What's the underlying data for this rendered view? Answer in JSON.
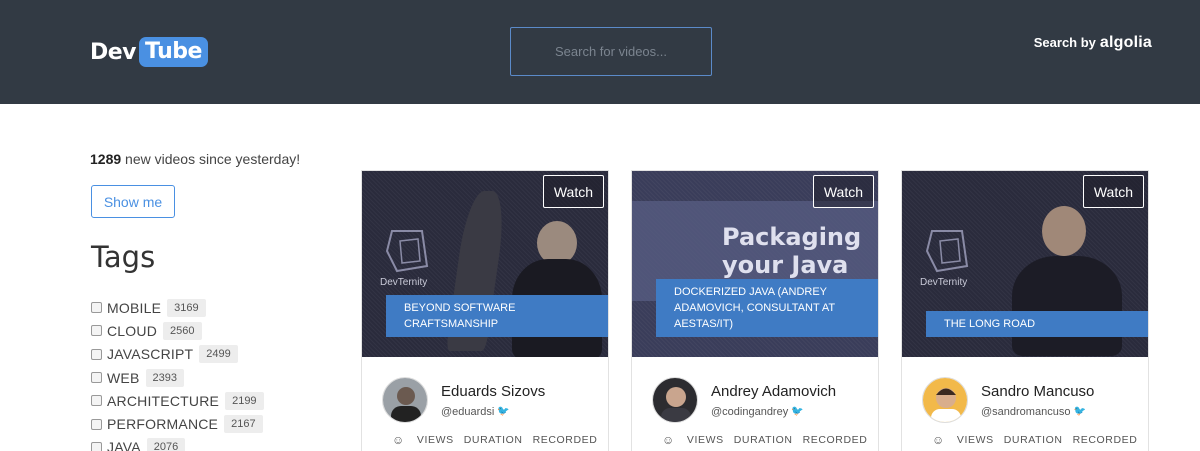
{
  "header": {
    "logo_dev": "Dev",
    "logo_tube": "Tube",
    "search_placeholder": "Search for videos...",
    "search_by": "Search by",
    "algolia": "algolia"
  },
  "sidebar": {
    "new_count": "1289",
    "new_text": " new videos since yesterday!",
    "show_me": "Show me",
    "tags_title": "Tags",
    "tags": [
      {
        "name": "MOBILE",
        "count": "3169"
      },
      {
        "name": "CLOUD",
        "count": "2560"
      },
      {
        "name": "JAVASCRIPT",
        "count": "2499"
      },
      {
        "name": "WEB",
        "count": "2393"
      },
      {
        "name": "ARCHITECTURE",
        "count": "2199"
      },
      {
        "name": "PERFORMANCE",
        "count": "2167"
      },
      {
        "name": "JAVA",
        "count": "2076"
      }
    ]
  },
  "videos": [
    {
      "watch": "Watch",
      "thumb_brand": "DevTernity",
      "caption": "BEYOND SOFTWARE CRAFTSMANSHIP",
      "speaker": "Eduards Sizovs",
      "handle": "@eduardsi",
      "stats": [
        "VIEWS",
        "DURATION",
        "RECORDED"
      ]
    },
    {
      "watch": "Watch",
      "thumb_brand": "",
      "thumb_title": "Packaging your Java",
      "caption": "DOCKERIZED JAVA (ANDREY ADAMOVICH, CONSULTANT AT AESTAS/IT)",
      "speaker": "Andrey Adamovich",
      "handle": "@codingandrey",
      "stats": [
        "VIEWS",
        "DURATION",
        "RECORDED"
      ]
    },
    {
      "watch": "Watch",
      "thumb_brand": "DevTernity",
      "caption": "THE LONG ROAD",
      "speaker": "Sandro Mancuso",
      "handle": "@sandromancuso",
      "stats": [
        "VIEWS",
        "DURATION",
        "RECORDED"
      ]
    }
  ],
  "colors": {
    "header_bg": "#323a44",
    "accent": "#4a90e2",
    "caption_bg": "#3f7bc4"
  }
}
